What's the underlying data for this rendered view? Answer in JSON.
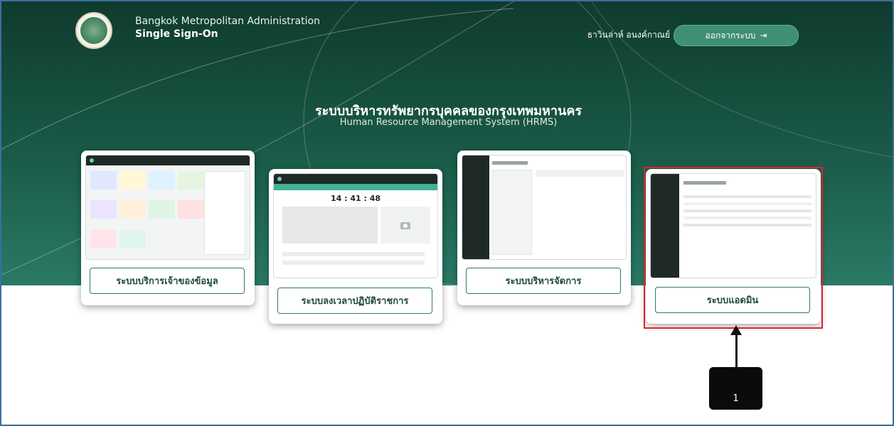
{
  "header": {
    "org_line1": "Bangkok Metropolitan Administration",
    "org_line2": "Single Sign-On",
    "user_name": "ธาวินล่าห์ อนงค์กาณย์",
    "logout_label": "ออกจากระบบ"
  },
  "hero": {
    "title": "ระบบบริหารทรัพยากรบุคคลของกรุงเทพมหานคร",
    "subtitle": "Human Resource Management System (HRMS)"
  },
  "cards": [
    {
      "label": "ระบบบริการเจ้าของข้อมูล"
    },
    {
      "label": "ระบบลงเวลาปฏิบัติราชการ",
      "clock": "14 : 41 : 48"
    },
    {
      "label": "ระบบบริหารจัดการ"
    },
    {
      "label": "ระบบแอดมิน"
    }
  ],
  "annotation": {
    "number": "1"
  },
  "colors": {
    "hero": "#1a5b48",
    "accent": "#3e8f73",
    "highlight": "#e0242b"
  }
}
